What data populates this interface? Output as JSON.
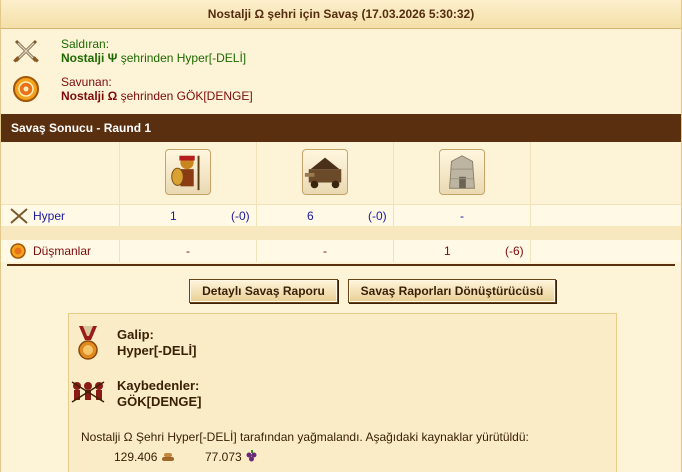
{
  "title": "Nostalji Ω şehri için Savaş (17.03.2026 5:30:32)",
  "attacker": {
    "role": "Saldıran:",
    "city": "Nostalji Ψ",
    "rest": " şehrinden Hyper[-DELİ]"
  },
  "defender": {
    "role": "Savunan:",
    "city": "Nostalji Ω",
    "rest": " şehrinden GÖK[DENGE]"
  },
  "result_title": "Savaş Sonucu - Raund 1",
  "rows": {
    "attacker_name": "Hyper",
    "attacker_cells": [
      {
        "count": "1",
        "loss": "(-0)"
      },
      {
        "count": "6",
        "loss": "(-0)"
      },
      {
        "count": "-",
        "loss": ""
      }
    ],
    "defender_name": "Düşmanlar",
    "defender_cells": [
      {
        "count": "-",
        "loss": ""
      },
      {
        "count": "-",
        "loss": ""
      },
      {
        "count": "1",
        "loss": "(-6)"
      }
    ]
  },
  "buttons": {
    "detailed": "Detaylı Savaş Raporu",
    "converter": "Savaş Raporları Dönüştürücüsü"
  },
  "report": {
    "winner_label": "Galip:",
    "winner_name": "Hyper[-DELİ]",
    "loser_label": "Kaybedenler:",
    "loser_name": "GÖK[DENGE]",
    "summary": "Nostalji Ω Şehri Hyper[-DELİ] tarafından yağmalandı. Aşağıdaki kaynaklar yürütüldü:",
    "resource_1": "129.406",
    "resource_2": "77.073"
  },
  "icons": {
    "attacker": "crossed-swords-icon",
    "defender": "shield-icon",
    "winner": "medal-icon",
    "loser": "fallen-soldiers-icon",
    "unit_1": "hoplite-unit-icon",
    "unit_2": "ram-unit-icon",
    "unit_3": "wall-icon",
    "resource_1": "wood-icon",
    "resource_2": "wine-icon"
  },
  "colors": {
    "attacker": "#1d6a00",
    "defender": "#7c0b0b",
    "name_link": "#1a1aa0",
    "header_bar": "#5a2f0f"
  }
}
